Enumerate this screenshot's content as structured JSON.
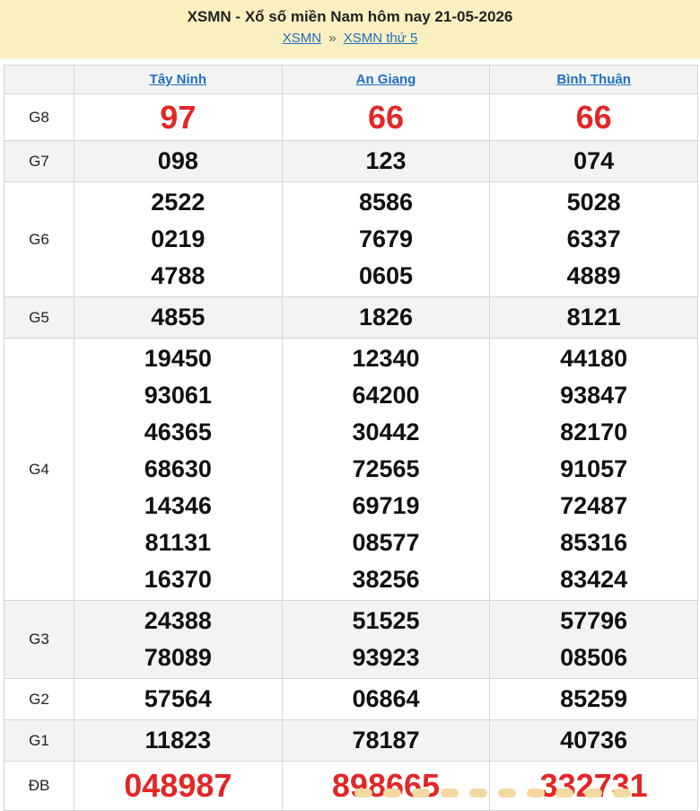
{
  "header": {
    "title": "XSMN - Xổ số miền Nam hôm nay 21-05-2026",
    "crumb1": "XSMN",
    "separator": "»",
    "crumb2": "XSMN thứ 5"
  },
  "provinces": [
    "Tây Ninh",
    "An Giang",
    "Bình Thuận"
  ],
  "prizes": [
    {
      "name": "G8",
      "values": [
        [
          "97"
        ],
        [
          "66"
        ],
        [
          "66"
        ]
      ]
    },
    {
      "name": "G7",
      "values": [
        [
          "098"
        ],
        [
          "123"
        ],
        [
          "074"
        ]
      ]
    },
    {
      "name": "G6",
      "values": [
        [
          "2522",
          "0219",
          "4788"
        ],
        [
          "8586",
          "7679",
          "0605"
        ],
        [
          "5028",
          "6337",
          "4889"
        ]
      ]
    },
    {
      "name": "G5",
      "values": [
        [
          "4855"
        ],
        [
          "1826"
        ],
        [
          "8121"
        ]
      ]
    },
    {
      "name": "G4",
      "values": [
        [
          "19450",
          "93061",
          "46365",
          "68630",
          "14346",
          "81131",
          "16370"
        ],
        [
          "12340",
          "64200",
          "30442",
          "72565",
          "69719",
          "08577",
          "38256"
        ],
        [
          "44180",
          "93847",
          "82170",
          "91057",
          "72487",
          "85316",
          "83424"
        ]
      ]
    },
    {
      "name": "G3",
      "values": [
        [
          "24388",
          "78089"
        ],
        [
          "51525",
          "93923"
        ],
        [
          "57796",
          "08506"
        ]
      ]
    },
    {
      "name": "G2",
      "values": [
        [
          "57564"
        ],
        [
          "06864"
        ],
        [
          "85259"
        ]
      ]
    },
    {
      "name": "G1",
      "values": [
        [
          "11823"
        ],
        [
          "78187"
        ],
        [
          "40736"
        ]
      ]
    },
    {
      "name": "ĐB",
      "values": [
        [
          "048987"
        ],
        [
          "898665"
        ],
        [
          "332731"
        ]
      ]
    }
  ],
  "colors": {
    "header_bg": "#fdf0c0",
    "link": "#1f6fc6",
    "special_red": "#e32626",
    "shade": "#f3f3f3"
  }
}
